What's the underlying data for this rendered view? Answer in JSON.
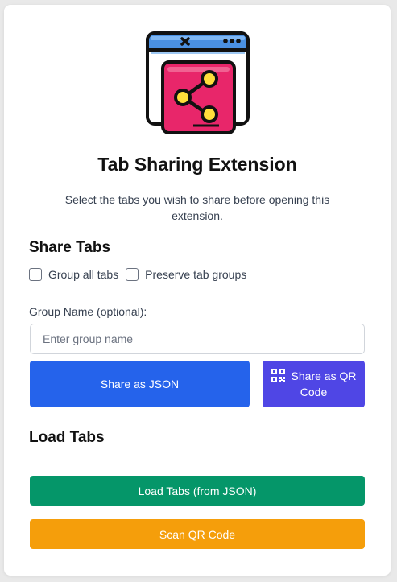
{
  "app": {
    "title": "Tab Sharing Extension",
    "subtitle": "Select the tabs you wish to share before opening this extension."
  },
  "share": {
    "heading": "Share Tabs",
    "options": [
      {
        "label": "Group all tabs",
        "checked": false
      },
      {
        "label": "Preserve tab groups",
        "checked": false
      }
    ],
    "group_name_label": "Group Name (optional):",
    "group_name_placeholder": "Enter group name",
    "share_json_label": "Share as JSON",
    "share_qr_label": "Share as QR Code"
  },
  "load": {
    "heading": "Load Tabs",
    "load_json_label": "Load Tabs (from JSON)",
    "scan_qr_label": "Scan QR Code"
  },
  "icons": {
    "logo": "browser-share-icon",
    "qr": "qr-code-icon"
  },
  "colors": {
    "share_json": "#2563eb",
    "share_qr": "#4f46e5",
    "load_json": "#059669",
    "scan_qr": "#f59e0b",
    "logo_pink": "#e8266a",
    "logo_blue": "#3b82f6",
    "logo_yellow": "#ffde3b"
  }
}
